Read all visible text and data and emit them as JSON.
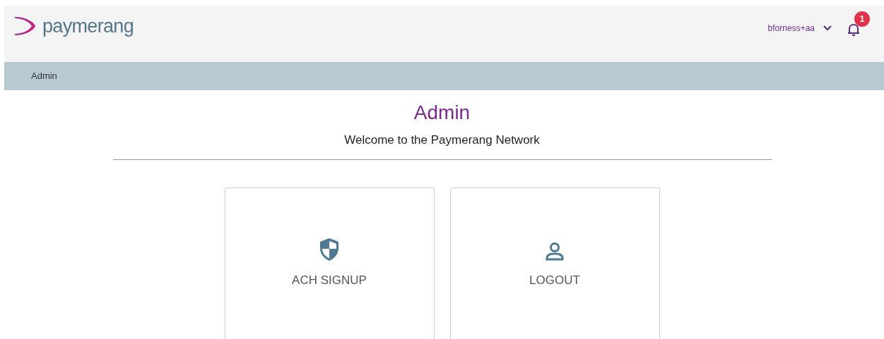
{
  "header": {
    "logo_text": "paymerang",
    "username": "bforness+aa",
    "notification_count": "1"
  },
  "breadcrumb": "Admin",
  "page": {
    "title": "Admin",
    "subtitle": "Welcome to the Paymerang Network"
  },
  "cards": [
    {
      "kind": "shield",
      "label": "ACH SIGNUP"
    },
    {
      "kind": "user",
      "label": "LOGOUT"
    }
  ]
}
